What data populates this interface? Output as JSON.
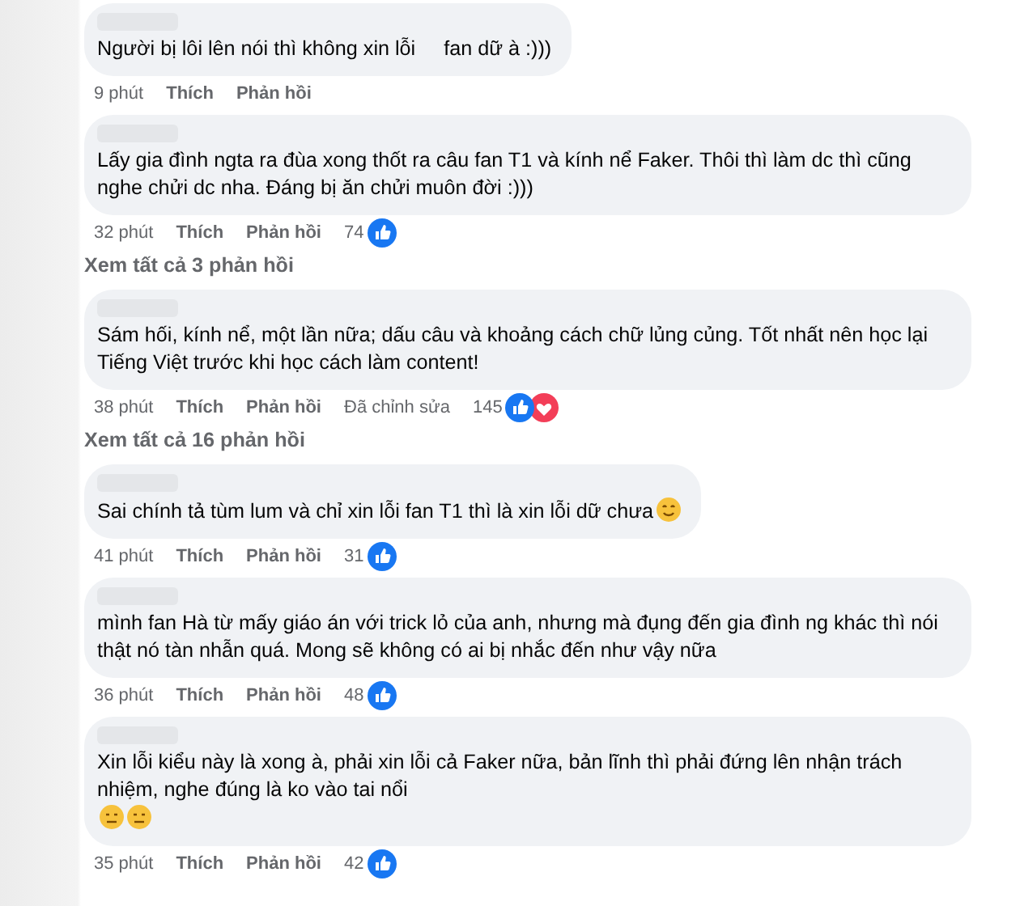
{
  "comments": [
    {
      "text": "Người bị lôi lên nói thì không xin lỗi     fan dữ à :)))",
      "time": "9 phút",
      "like": "Thích",
      "reply": "Phản hồi"
    },
    {
      "text": "Lấy gia đình ngta ra đùa xong thốt ra câu fan T1 và kính nể Faker. Thôi thì làm dc thì cũng nghe chửi dc nha. Đáng bị ăn chửi muôn đời :)))",
      "time": "32 phút",
      "like": "Thích",
      "reply": "Phản hồi",
      "reaction_count": "74",
      "reactions": [
        {
          "kind": "like"
        }
      ],
      "view_replies": "Xem tất cả 3 phản hồi"
    },
    {
      "text": "Sám hối, kính nể, một lần nữa; dấu câu và khoảng cách chữ lủng củng. Tốt nhất nên học lại Tiếng Việt trước khi học cách làm content!",
      "time": "38 phút",
      "like": "Thích",
      "reply": "Phản hồi",
      "edited": "Đã chỉnh sửa",
      "reaction_count": "145",
      "reactions": [
        {
          "kind": "like"
        },
        {
          "kind": "love"
        }
      ],
      "view_replies": "Xem tất cả 16 phản hồi"
    },
    {
      "text": "Sai chính tả tùm lum và chỉ xin lỗi fan T1 thì là xin lỗi dữ chưa",
      "emojis": [
        {
          "kind": "smile"
        }
      ],
      "time": "41 phút",
      "like": "Thích",
      "reply": "Phản hồi",
      "reaction_count": "31",
      "reactions": [
        {
          "kind": "like"
        }
      ]
    },
    {
      "text": "mình fan Hà từ mấy giáo án với trick lỏ của anh, nhưng mà đụng đến gia đình ng khác thì nói thật nó tàn nhẫn quá. Mong sẽ không có ai bị nhắc đến như vậy nữa",
      "time": "36 phút",
      "like": "Thích",
      "reply": "Phản hồi",
      "reaction_count": "48",
      "reactions": [
        {
          "kind": "like"
        }
      ]
    },
    {
      "text": "Xin lỗi kiểu này là xong à, phải xin lỗi cả Faker nữa, bản lĩnh thì phải đứng lên nhận trách nhiệm, nghe đúng là ko vào tai nổi",
      "emojis": [
        {
          "kind": "neutral"
        },
        {
          "kind": "neutral"
        }
      ],
      "time": "35 phút",
      "like": "Thích",
      "reply": "Phản hồi",
      "reaction_count": "42",
      "reactions": [
        {
          "kind": "like"
        }
      ]
    }
  ]
}
